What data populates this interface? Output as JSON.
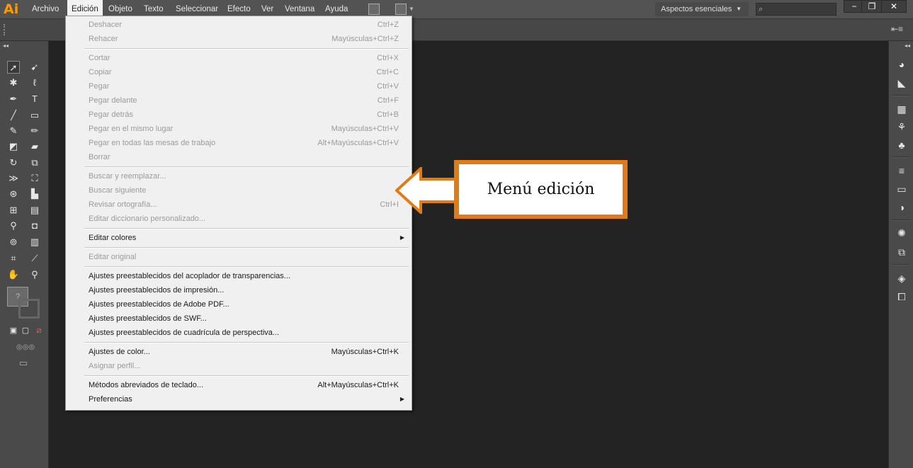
{
  "app": {
    "logo": "Ai"
  },
  "menubar": {
    "items": [
      {
        "label": "Archivo",
        "active": false
      },
      {
        "label": "Edición",
        "active": true
      },
      {
        "label": "Objeto",
        "active": false
      },
      {
        "label": "Texto",
        "active": false
      },
      {
        "label": "Seleccionar",
        "active": false
      },
      {
        "label": "Efecto",
        "active": false
      },
      {
        "label": "Ver",
        "active": false
      },
      {
        "label": "Ventana",
        "active": false
      },
      {
        "label": "Ayuda",
        "active": false
      }
    ],
    "workspace": "Aspectos esenciales",
    "search_placeholder": ""
  },
  "window_controls": {
    "minimize": "−",
    "restore": "❐",
    "close": "✕"
  },
  "edit_menu": {
    "groups": [
      [
        {
          "label": "Deshacer",
          "shortcut": "Ctrl+Z",
          "enabled": false
        },
        {
          "label": "Rehacer",
          "shortcut": "Mayúsculas+Ctrl+Z",
          "enabled": false
        }
      ],
      [
        {
          "label": "Cortar",
          "shortcut": "Ctrl+X",
          "enabled": false
        },
        {
          "label": "Copiar",
          "shortcut": "Ctrl+C",
          "enabled": false
        },
        {
          "label": "Pegar",
          "shortcut": "Ctrl+V",
          "enabled": false
        },
        {
          "label": "Pegar delante",
          "shortcut": "Ctrl+F",
          "enabled": false
        },
        {
          "label": "Pegar detrás",
          "shortcut": "Ctrl+B",
          "enabled": false
        },
        {
          "label": "Pegar en el mismo lugar",
          "shortcut": "Mayúsculas+Ctrl+V",
          "enabled": false
        },
        {
          "label": "Pegar en todas las mesas de trabajo",
          "shortcut": "Alt+Mayúsculas+Ctrl+V",
          "enabled": false
        },
        {
          "label": "Borrar",
          "shortcut": "",
          "enabled": false
        }
      ],
      [
        {
          "label": "Buscar y reemplazar...",
          "shortcut": "",
          "enabled": false
        },
        {
          "label": "Buscar siguiente",
          "shortcut": "",
          "enabled": false
        },
        {
          "label": "Revisar ortografía...",
          "shortcut": "Ctrl+I",
          "enabled": false
        },
        {
          "label": "Editar diccionario personalizado...",
          "shortcut": "",
          "enabled": false
        }
      ],
      [
        {
          "label": "Editar colores",
          "shortcut": "",
          "enabled": true,
          "submenu": true
        }
      ],
      [
        {
          "label": "Editar original",
          "shortcut": "",
          "enabled": false
        }
      ],
      [
        {
          "label": "Ajustes preestablecidos del acoplador de transparencias...",
          "shortcut": "",
          "enabled": true
        },
        {
          "label": "Ajustes preestablecidos de impresión...",
          "shortcut": "",
          "enabled": true
        },
        {
          "label": "Ajustes preestablecidos de Adobe PDF...",
          "shortcut": "",
          "enabled": true
        },
        {
          "label": "Ajustes preestablecidos de SWF...",
          "shortcut": "",
          "enabled": true
        },
        {
          "label": "Ajustes preestablecidos de cuadrícula de perspectiva...",
          "shortcut": "",
          "enabled": true
        }
      ],
      [
        {
          "label": "Ajustes de color...",
          "shortcut": "Mayúsculas+Ctrl+K",
          "enabled": true
        },
        {
          "label": "Asignar perfil...",
          "shortcut": "",
          "enabled": false
        }
      ],
      [
        {
          "label": "Métodos abreviados de teclado...",
          "shortcut": "Alt+Mayúsculas+Ctrl+K",
          "enabled": true
        },
        {
          "label": "Preferencias",
          "shortcut": "",
          "enabled": true,
          "submenu": true
        }
      ]
    ]
  },
  "callout": {
    "text": "Menú edición",
    "border_color": "#e27b16"
  },
  "colors": {
    "accent": "#ff9a00",
    "callout": "#e27b16",
    "menu_bg": "#f0f0f0",
    "canvas": "#232323"
  }
}
